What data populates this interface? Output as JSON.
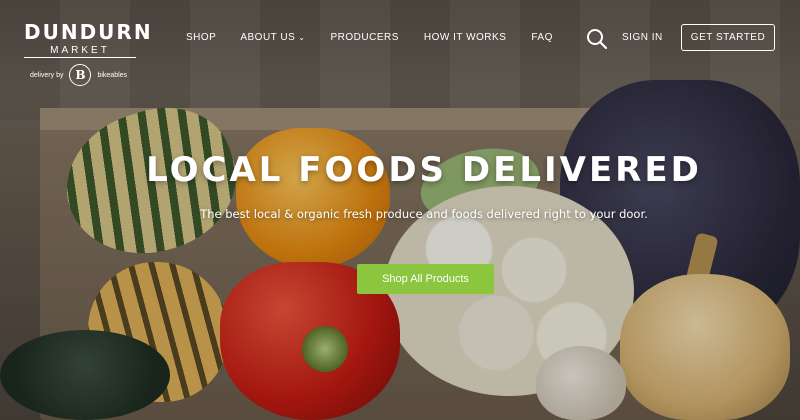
{
  "logo": {
    "name": "DUNDURN",
    "subname": "MARKET",
    "delivery_by": "delivery by",
    "partner_mark": "B",
    "partner_name": "bikeables"
  },
  "nav": {
    "items": [
      {
        "label": "SHOP",
        "has_dropdown": false
      },
      {
        "label": "ABOUT US",
        "has_dropdown": true
      },
      {
        "label": "PRODUCERS",
        "has_dropdown": false
      },
      {
        "label": "HOW IT WORKS",
        "has_dropdown": false
      },
      {
        "label": "FAQ",
        "has_dropdown": false
      }
    ],
    "dropdown_glyph": "⌄"
  },
  "header_actions": {
    "search_icon": "search-icon",
    "signin_label": "SIGN IN",
    "get_started_label": "GET STARTED"
  },
  "hero": {
    "title": "LOCAL FOODS DELIVERED",
    "subtitle": "The best local & organic fresh produce and foods delivered right to your door.",
    "cta_label": "Shop All Products"
  },
  "colors": {
    "cta_green": "#8cc63f",
    "text_white": "#ffffff"
  }
}
